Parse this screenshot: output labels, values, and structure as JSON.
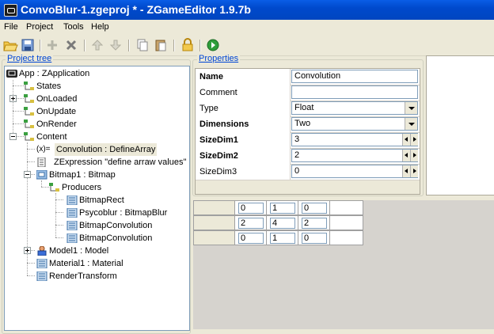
{
  "window": {
    "title": "ConvoBlur-1.zgeproj * - ZGameEditor 1.9.7b"
  },
  "menu": [
    "File",
    "Project",
    "Tools",
    "Help"
  ],
  "project_tree": {
    "title": "Project tree",
    "nodes": [
      {
        "label": "App : ZApplication"
      },
      {
        "label": "States"
      },
      {
        "label": "OnLoaded"
      },
      {
        "label": "OnUpdate"
      },
      {
        "label": "OnRender"
      },
      {
        "label": "Content"
      },
      {
        "label": "Convolution : DefineArray",
        "icon_text": "(x)="
      },
      {
        "label": "ZExpression \"define arraw values\""
      },
      {
        "label": "Bitmap1 : Bitmap"
      },
      {
        "label": "Producers"
      },
      {
        "label": "BitmapRect"
      },
      {
        "label": "Psycoblur : BitmapBlur"
      },
      {
        "label": "BitmapConvolution"
      },
      {
        "label": "BitmapConvolution"
      },
      {
        "label": "Model1 : Model"
      },
      {
        "label": "Material1 : Material"
      },
      {
        "label": "RenderTransform"
      }
    ]
  },
  "properties": {
    "title": "Properties",
    "rows": [
      {
        "name": "Name",
        "value": "Convolution"
      },
      {
        "name": "Comment",
        "value": ""
      },
      {
        "name": "Type",
        "value": "Float"
      },
      {
        "name": "Dimensions",
        "value": "Two"
      },
      {
        "name": "SizeDim1",
        "value": "3"
      },
      {
        "name": "SizeDim2",
        "value": "2"
      },
      {
        "name": "SizeDim3",
        "value": "0"
      }
    ]
  },
  "array_grid": {
    "rows": [
      [
        "0",
        "1",
        "0"
      ],
      [
        "2",
        "4",
        "2"
      ],
      [
        "0",
        "1",
        "0"
      ]
    ]
  }
}
